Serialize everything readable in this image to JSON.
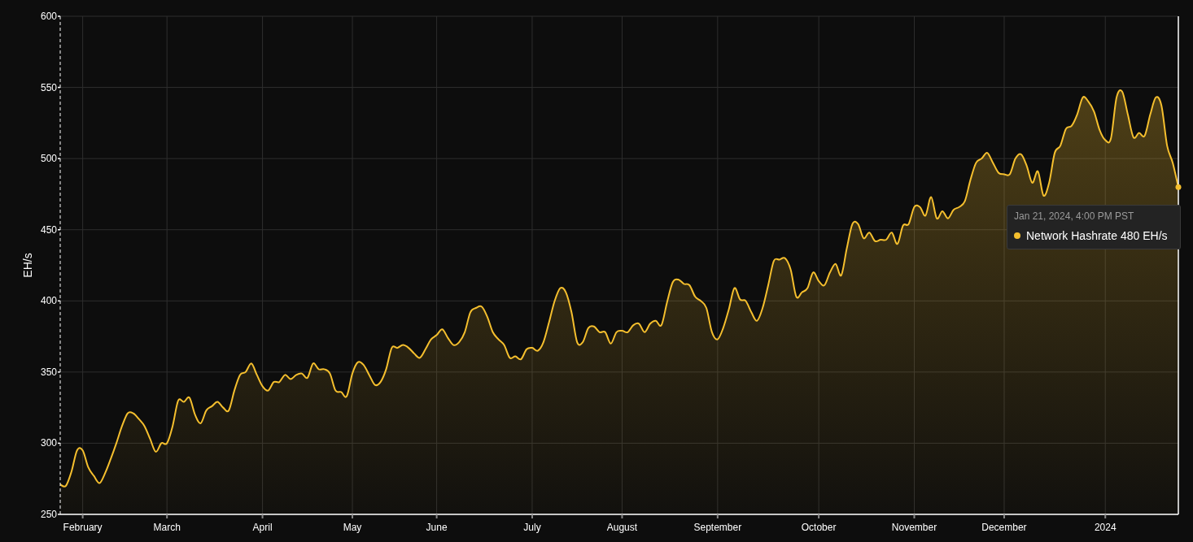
{
  "chart": {
    "chart_data": {
      "type": "area",
      "grid": true,
      "ylabel": "EH/s",
      "ylim": [
        250,
        600
      ],
      "yticks": [
        250,
        300,
        350,
        400,
        450,
        500,
        550,
        600
      ],
      "categories": [
        null,
        null,
        null,
        null,
        "February",
        null,
        null,
        null,
        null,
        null,
        null,
        null,
        null,
        null,
        null,
        null,
        null,
        null,
        null,
        "March",
        null,
        null,
        null,
        null,
        null,
        null,
        null,
        null,
        null,
        null,
        null,
        null,
        null,
        null,
        null,
        null,
        "April",
        null,
        null,
        null,
        null,
        null,
        null,
        null,
        null,
        null,
        null,
        null,
        null,
        null,
        null,
        null,
        "May",
        null,
        null,
        null,
        null,
        null,
        null,
        null,
        null,
        null,
        null,
        null,
        null,
        null,
        null,
        "June",
        null,
        null,
        null,
        null,
        null,
        null,
        null,
        null,
        null,
        null,
        null,
        null,
        null,
        null,
        null,
        null,
        "July",
        null,
        null,
        null,
        null,
        null,
        null,
        null,
        null,
        null,
        null,
        null,
        null,
        null,
        null,
        null,
        "August",
        null,
        null,
        null,
        null,
        null,
        null,
        null,
        null,
        null,
        null,
        null,
        null,
        null,
        null,
        null,
        null,
        "September",
        null,
        null,
        null,
        null,
        null,
        null,
        null,
        null,
        null,
        null,
        null,
        null,
        null,
        null,
        null,
        null,
        null,
        "October",
        null,
        null,
        null,
        null,
        null,
        null,
        null,
        null,
        null,
        null,
        null,
        null,
        null,
        null,
        null,
        null,
        "November",
        null,
        null,
        null,
        null,
        null,
        null,
        null,
        null,
        null,
        null,
        null,
        null,
        null,
        null,
        null,
        "December",
        null,
        null,
        null,
        null,
        null,
        null,
        null,
        null,
        null,
        null,
        null,
        null,
        null,
        null,
        null,
        null,
        null,
        "2024",
        null,
        null,
        null,
        null,
        null,
        null,
        null,
        null,
        null,
        null,
        null,
        null,
        null
      ],
      "series": [
        {
          "color": "#f5bf2e",
          "values": [
            271,
            270,
            280,
            295,
            295,
            283,
            277,
            272,
            279,
            289,
            300,
            312,
            321,
            321,
            317,
            312,
            303,
            294,
            300,
            300,
            312,
            330,
            329,
            332,
            320,
            314,
            323,
            326,
            329,
            325,
            323,
            337,
            348,
            350,
            356,
            348,
            340,
            337,
            343,
            343,
            348,
            345,
            348,
            349,
            346,
            356,
            352,
            352,
            349,
            337,
            336,
            333,
            349,
            357,
            355,
            348,
            341,
            343,
            352,
            367,
            367,
            369,
            367,
            363,
            360,
            366,
            373,
            376,
            380,
            374,
            369,
            371,
            378,
            392,
            395,
            396,
            389,
            378,
            373,
            369,
            360,
            361,
            359,
            366,
            367,
            365,
            371,
            385,
            400,
            409,
            406,
            392,
            371,
            371,
            381,
            382,
            378,
            378,
            370,
            378,
            379,
            378,
            383,
            384,
            378,
            384,
            386,
            383,
            399,
            413,
            415,
            412,
            411,
            403,
            400,
            395,
            378,
            373,
            381,
            394,
            409,
            401,
            400,
            392,
            386,
            395,
            411,
            428,
            429,
            430,
            422,
            403,
            406,
            409,
            420,
            414,
            411,
            420,
            426,
            418,
            437,
            454,
            454,
            444,
            448,
            442,
            443,
            443,
            448,
            440,
            453,
            454,
            466,
            466,
            460,
            473,
            458,
            463,
            458,
            464,
            466,
            470,
            485,
            497,
            500,
            504,
            497,
            490,
            489,
            489,
            500,
            503,
            495,
            483,
            491,
            474,
            483,
            504,
            509,
            521,
            523,
            531,
            543,
            540,
            533,
            520,
            513,
            514,
            543,
            547,
            531,
            515,
            518,
            516,
            531,
            543,
            537,
            509,
            497,
            480
          ]
        }
      ]
    }
  },
  "tooltip": {
    "time": "Jan 21, 2024, 4:00 PM PST",
    "label": "Network Hashrate 480 EH/s",
    "color": "#f5bf2e"
  }
}
